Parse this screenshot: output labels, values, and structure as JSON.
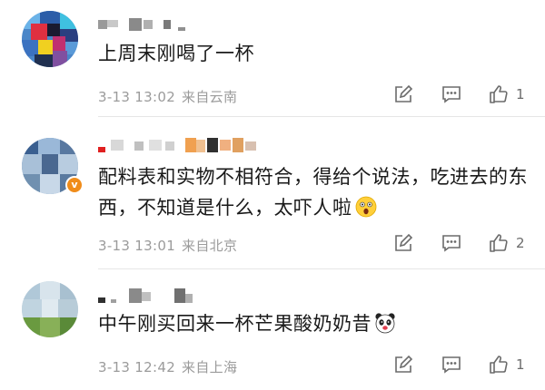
{
  "comments": [
    {
      "text": "上周末刚喝了一杯",
      "time": "3-13 13:02",
      "location": "来自云南",
      "likes": "1",
      "verified": false
    },
    {
      "text": "配料表和实物不相符合，得给个说法，吃进去的东西，不知道是什么，太吓人啦",
      "time": "3-13 13:01",
      "location": "来自北京",
      "likes": "2",
      "verified": true,
      "emoji": "scared-face"
    },
    {
      "text": "中午刚买回来一杯芒果酸奶奶昔",
      "time": "3-13 12:42",
      "location": "来自上海",
      "likes": "1",
      "verified": false,
      "emoji": "panda-face"
    }
  ],
  "colors": {
    "text": "#1a1a1a",
    "meta": "#9b9b9b",
    "icon": "#6b6b6b",
    "divider": "#e6e6e6",
    "verified_badge": "#f08c1a"
  },
  "icons": [
    "edit-icon",
    "comment-icon",
    "like-icon"
  ]
}
